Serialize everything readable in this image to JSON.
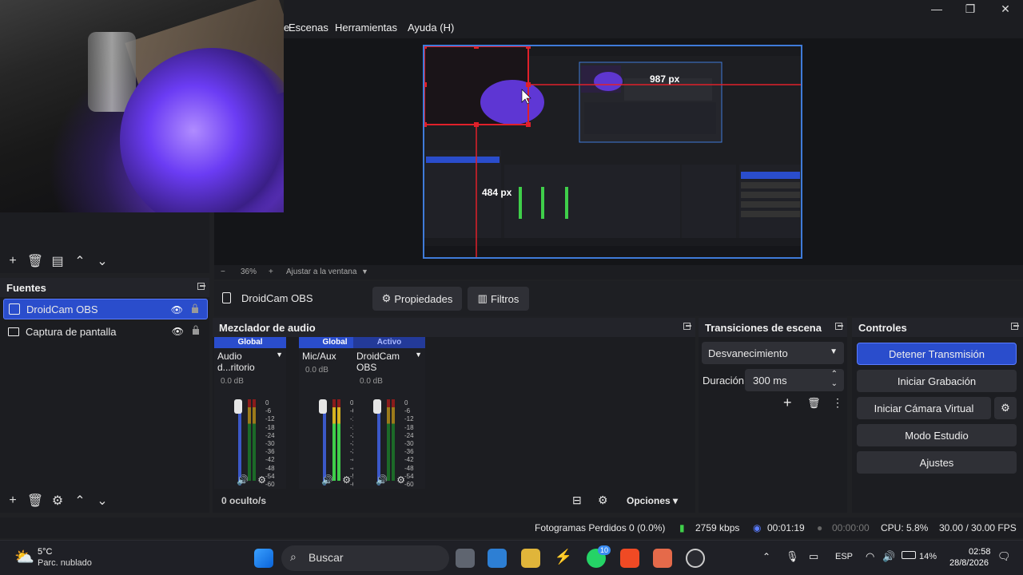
{
  "menu": {
    "escenas": "Escenas",
    "herramientas": "Herramientas",
    "ayuda": "Ayuda (H)",
    "partial_prefix": "e"
  },
  "window": {
    "minimize": "—",
    "maximize": "❐",
    "close": "✕"
  },
  "preview": {
    "width_label": "987 px",
    "height_label": "484 px"
  },
  "zoom": {
    "minus": "−",
    "value": "36%",
    "plus": "+",
    "fit": "Ajustar a la ventana"
  },
  "source_toolbar": {
    "source_name": "DroidCam OBS",
    "properties": "Propiedades",
    "filters": "Filtros"
  },
  "sources": {
    "title": "Fuentes",
    "items": [
      {
        "label": "DroidCam OBS",
        "selected": true
      },
      {
        "label": "Captura de pantalla",
        "selected": false
      }
    ]
  },
  "mixer": {
    "title": "Mezclador de audio",
    "channels": [
      {
        "tag": "Global",
        "name": "Audio d...ritorio",
        "db": "0.0 dB"
      },
      {
        "tag": "Global",
        "name": "Mic/Aux",
        "db": "0.0 dB"
      },
      {
        "tag": "Activo",
        "name": "DroidCam OBS",
        "db": "0.0 dB"
      }
    ],
    "scale": [
      "0",
      "-6",
      "-12",
      "-18",
      "-24",
      "-30",
      "-36",
      "-42",
      "-48",
      "-54",
      "-60"
    ],
    "hidden": "0 oculto/s",
    "options": "Opciones"
  },
  "transitions": {
    "title": "Transiciones de escena",
    "type": "Desvanecimiento",
    "duration_label": "Duración",
    "duration_value": "300 ms"
  },
  "controls": {
    "title": "Controles",
    "stop_stream": "Detener Transmisión",
    "start_recording": "Iniciar Grabación",
    "virtual_camera": "Iniciar Cámara Virtual",
    "studio_mode": "Modo Estudio",
    "settings": "Ajustes"
  },
  "status": {
    "dropped": "Fotogramas Perdidos 0 (0.0%)",
    "bitrate": "2759 kbps",
    "stream_time": "00:01:19",
    "rec_time": "00:00:00",
    "cpu": "CPU: 5.8%",
    "fps": "30.00 / 30.00 FPS"
  },
  "taskbar": {
    "weather_temp": "5°C",
    "weather_desc": "Parc. nublado",
    "search": "Buscar",
    "badge": "10",
    "lang": "ESP",
    "battery": "14%",
    "time": "02:58",
    "date": "28/8/2026"
  },
  "colors": {
    "accent": "#2a4dcc",
    "bounding": "#e0202a",
    "preview_border": "#3f7bd9"
  }
}
